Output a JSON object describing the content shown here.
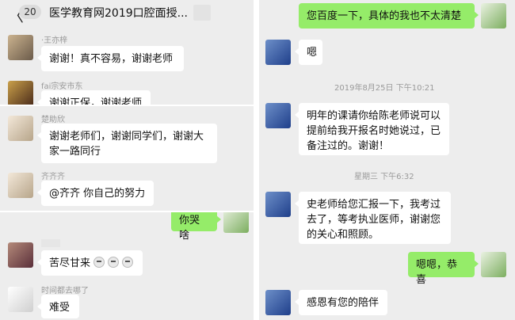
{
  "panel1": {
    "back_glyph": "〈",
    "unread_count": "20",
    "title": "医学教育网2019口腔面授...",
    "messages": [
      {
        "name": "·王亦梓",
        "text": "谢谢！真不容易，谢谢老师"
      },
      {
        "name": "fai宗安市东",
        "text": "谢谢正保，谢谢老师"
      }
    ]
  },
  "panel2": {
    "messages": [
      {
        "name": "楚助欣",
        "text": "谢谢老师们，谢谢同学们，谢谢大家一路同行"
      },
      {
        "name": "齐齐齐",
        "text": "@齐齐 你自己的努力"
      }
    ]
  },
  "panel3": {
    "my_message": "你哭啥",
    "messages": [
      {
        "name": "",
        "text": "苦尽甘来"
      },
      {
        "name": "时间都去哪了",
        "text": "难受"
      }
    ]
  },
  "panel4": {
    "my_top": "您百度一下，具体的我也不太清楚",
    "reply1": "嗯",
    "time1": "2019年8月25日 下午10:21",
    "reply2": "明年的课请你给陈老师说可以提前给我开报名时她说过，已备注过的。谢谢！",
    "time2": "星期三 下午6:32",
    "reply3": "史老师给您汇报一下，我考过去了，等考执业医师，谢谢您的关心和照顾。",
    "my_bottom": "嗯嗯，恭喜",
    "reply4": "感恩有您的陪伴"
  },
  "colors": {
    "chat_bg": "#ededed",
    "my_bubble": "#95ec69",
    "other_bubble": "#ffffff"
  }
}
